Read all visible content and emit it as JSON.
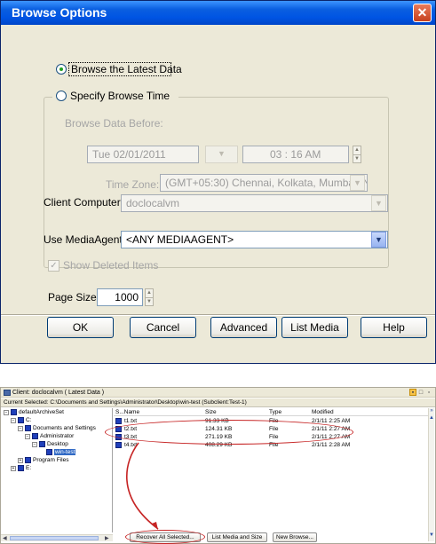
{
  "dialog": {
    "title": "Browse Options",
    "close_label": "✕",
    "browse_latest_label": "Browse the Latest Data",
    "specify_time_label": "Specify Browse Time",
    "browse_before_label": "Browse Data Before:",
    "date_value": "Tue 02/01/2011",
    "time_value": "03 : 16 AM",
    "timezone_label": "Time Zone:",
    "timezone_value": "(GMT+05:30) Chennai, Kolkata, Mumbai, N...",
    "client_computer_label": "Client Computer:",
    "client_computer_value": "doclocalvm",
    "use_mediaagent_label": "Use MediaAgent",
    "mediaagent_value": "<ANY MEDIAAGENT>",
    "show_deleted_label": "Show Deleted Items",
    "page_size_label": "Page Size:",
    "page_size_value": "1000",
    "buttons": {
      "ok": "OK",
      "cancel": "Cancel",
      "advanced": "Advanced",
      "list_media": "List Media",
      "help": "Help"
    }
  },
  "browse_window": {
    "title": "Client: doclocalvm ( Latest Data )",
    "current_selected": "Current Selected: C:\\Documents and Settings\\Administrator\\Desktop\\win-test (Subclient:Test-1)",
    "tree": [
      "defaultArchiveSet",
      "C:",
      "Documents and Settings",
      "Administrator",
      "Desktop",
      "win-test",
      "Program Files",
      "E:"
    ],
    "columns": [
      "S...Name",
      "Size",
      "Type",
      "Modified"
    ],
    "files": [
      {
        "name": "t1.txt",
        "size": "91.33 KB",
        "type": "File",
        "modified": "2/1/11 2:25 AM"
      },
      {
        "name": "t2.txt",
        "size": "124.31 KB",
        "type": "File",
        "modified": "2/1/11 2:27 AM"
      },
      {
        "name": "t3.txt",
        "size": "271.19 KB",
        "type": "File",
        "modified": "2/1/11 2:27 AM"
      },
      {
        "name": "t4.txt",
        "size": "408.29 KB",
        "type": "File",
        "modified": "2/1/11 2:28 AM"
      }
    ],
    "buttons": {
      "recover": "Recover All Selected...",
      "list_media_size": "List Media and Size",
      "new_browse": "New Browse..."
    }
  },
  "colors": {
    "titlebar": "#0054e3",
    "dialog_bg": "#ece9d8",
    "annotation_red": "#c62424"
  }
}
